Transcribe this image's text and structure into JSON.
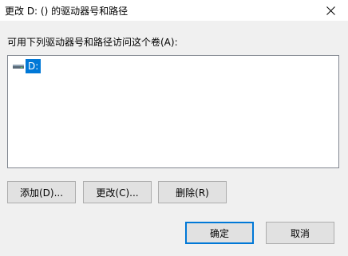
{
  "window": {
    "title": "更改 D: () 的驱动器号和路径"
  },
  "list": {
    "label": "可用下列驱动器号和路径访问这个卷(A):",
    "items": [
      {
        "label": "D:",
        "icon": "drive-icon",
        "selected": true
      }
    ]
  },
  "buttons": {
    "add": "添加(D)...",
    "change": "更改(C)...",
    "remove": "删除(R)",
    "ok": "确定",
    "cancel": "取消"
  },
  "colors": {
    "selection": "#0078d7",
    "default_button_border": "#0078d7"
  }
}
